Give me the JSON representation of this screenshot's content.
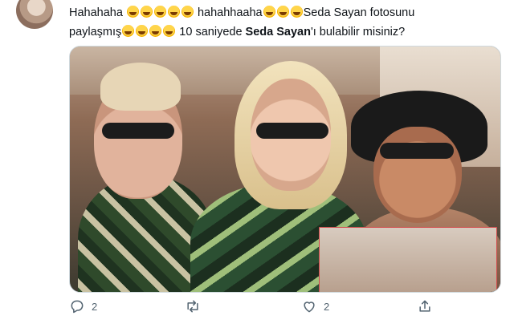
{
  "tweet": {
    "text_line1_a": "Hahahaha",
    "text_line1_b": "hahahhaaha",
    "text_line1_c": "Seda Sayan fotosunu",
    "text_line2_a": "paylaşmış",
    "text_line2_b": " 10 saniyede ",
    "text_line2_bold": "Seda Sayan",
    "text_line2_c": "'ı bulabilir misiniz?"
  },
  "actions": {
    "reply_count": "2",
    "like_count": "2"
  }
}
